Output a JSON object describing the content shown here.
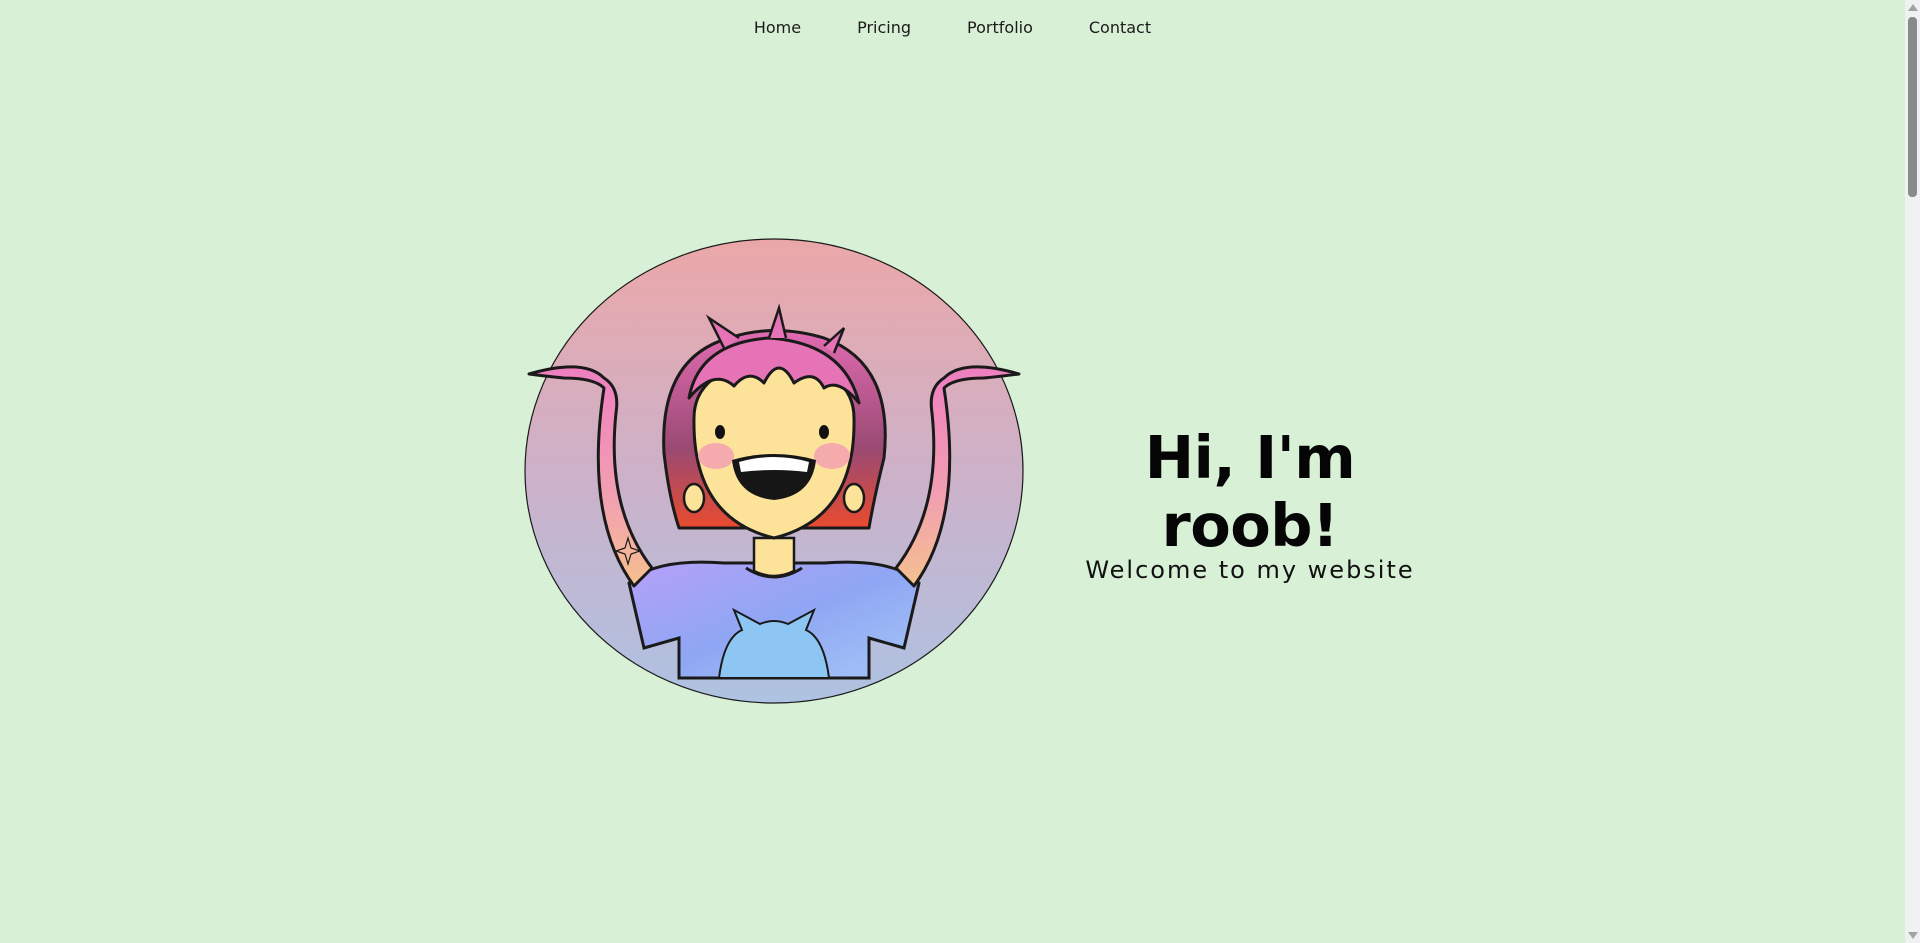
{
  "nav": {
    "items": [
      {
        "label": "Home"
      },
      {
        "label": "Pricing"
      },
      {
        "label": "Portfolio"
      },
      {
        "label": "Contact"
      }
    ]
  },
  "hero": {
    "title": "Hi, I'm roob!",
    "subtitle": "Welcome to my website",
    "avatar_icon": "smiling-character-illustration"
  },
  "colors": {
    "background": "#d8f0d6",
    "avatar_gradient_top": "#eba7a8",
    "avatar_gradient_bottom": "#aec2e2",
    "hair": "#d6609f",
    "skin": "#fde39a",
    "shirt": "#9fa6f5"
  }
}
